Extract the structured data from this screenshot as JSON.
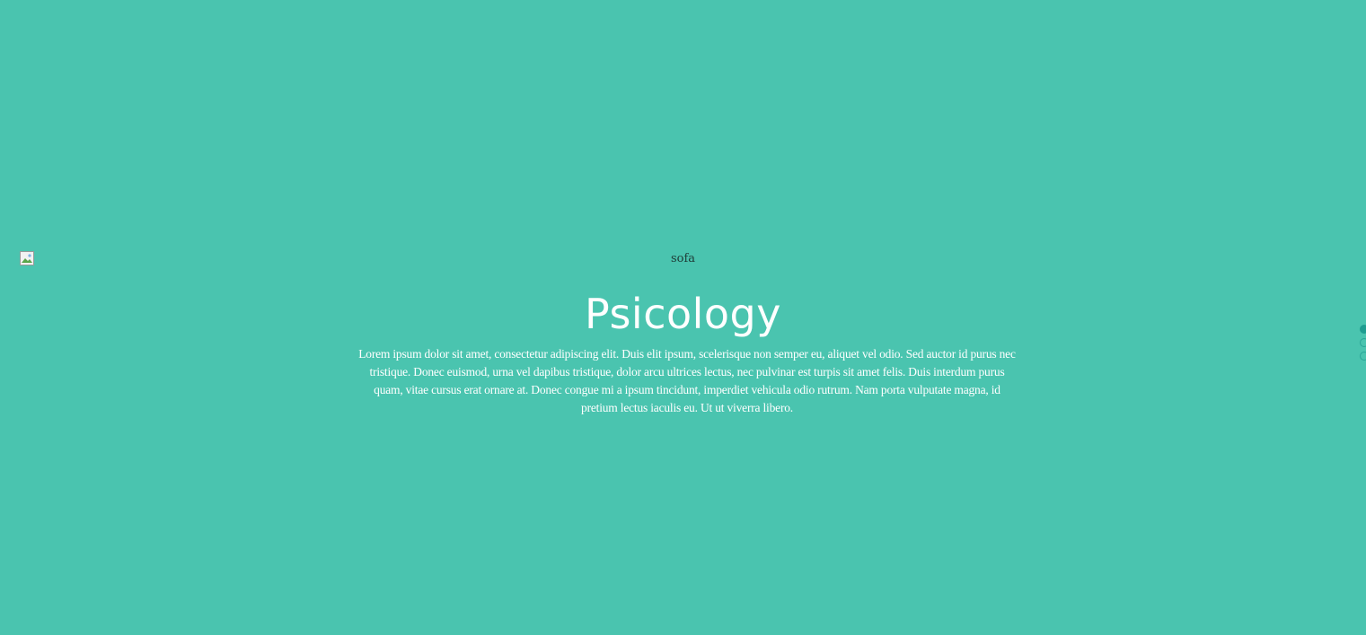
{
  "slide": {
    "image_alt": "sofa",
    "title": "Psicology",
    "description": "Lorem ipsum dolor sit amet, consectetur adipiscing elit. Duis elit ipsum, scelerisque non semper eu, aliquet vel odio. Sed auctor id purus nec tristique. Donec euismod, urna vel dapibus tristique, dolor arcu ultrices lectus, nec pulvinar est turpis sit amet felis. Duis interdum purus quam, vitae cursus erat ornare at. Donec congue mi a ipsum tincidunt, imperdiet vehicula odio rutrum. Nam porta vulputate magna, id pretium lectus iaculis eu. Ut ut viverra libero."
  },
  "pagination": {
    "count": 3,
    "active_index": 0
  },
  "colors": {
    "background": "#4ac4af",
    "text": "#ffffff",
    "accent": "#1f9d90"
  }
}
